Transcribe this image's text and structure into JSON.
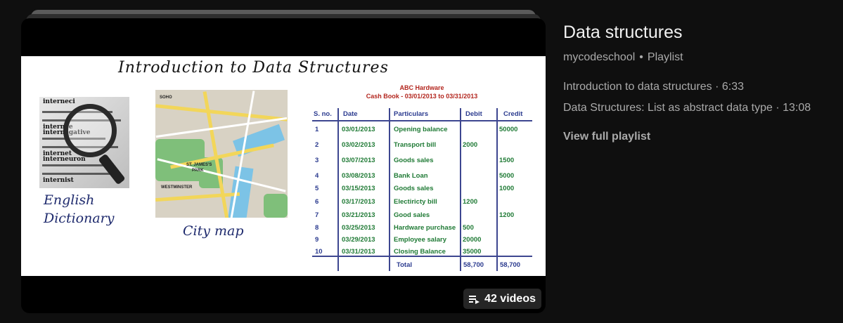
{
  "playlist": {
    "title": "Data structures",
    "channel": "mycodeschool",
    "separator": "•",
    "kind": "Playlist",
    "videos": [
      {
        "title": "Introduction to data structures",
        "duration": "6:33"
      },
      {
        "title": "Data Structures: List as abstract data type",
        "duration": "13:08"
      }
    ],
    "view_full": "View full playlist",
    "video_count": "42 videos"
  },
  "thumbnail": {
    "slide_title": "Introduction to Data Structures",
    "dictionary_words": [
      "interneci",
      "internee",
      "internegative",
      "internet",
      "interneuron",
      "internist"
    ],
    "dictionary_caption_1": "English",
    "dictionary_caption_2": "Dictionary",
    "map_caption": "City map",
    "map_labels": [
      "SOHO",
      "ST. JAMES'S",
      "PARK",
      "WESTMINSTER"
    ],
    "cashbook": {
      "company": "ABC Hardware",
      "subtitle": "Cash Book - 03/01/2013  to  03/31/2013",
      "headers": [
        "S. no.",
        "Date",
        "Particulars",
        "Debit",
        "Credit"
      ],
      "rows": [
        [
          "1",
          "03/01/2013",
          "Opening balance",
          "",
          "50000"
        ],
        [
          "2",
          "03/02/2013",
          "Transport bill",
          "2000",
          ""
        ],
        [
          "3",
          "03/07/2013",
          "Goods sales",
          "",
          "1500"
        ],
        [
          "4",
          "03/08/2013",
          "Bank Loan",
          "",
          "5000"
        ],
        [
          "5",
          "03/15/2013",
          "Goods sales",
          "",
          "1000"
        ],
        [
          "6",
          "03/17/2013",
          "Electiricty bill",
          "1200",
          ""
        ],
        [
          "7",
          "03/21/2013",
          "Good sales",
          "",
          "1200"
        ],
        [
          "8",
          "03/25/2013",
          "Hardware purchase",
          "500",
          ""
        ],
        [
          "9",
          "03/29/2013",
          "Employee salary",
          "20000",
          ""
        ],
        [
          "10",
          "03/31/2013",
          "Closing Balance",
          "35000",
          ""
        ]
      ],
      "total_label": "Total",
      "total_debit": "58,700",
      "total_credit": "58,700"
    }
  },
  "colors": {
    "background": "#0f0f0f",
    "primary_text": "#f1f1f1",
    "secondary_text": "#aaaaaa",
    "cashbook_green": "#1f7a35",
    "cashbook_blue": "#2b3b8f",
    "cashbook_red": "#b3261e"
  },
  "icons": {
    "badge": "playlist-icon"
  }
}
